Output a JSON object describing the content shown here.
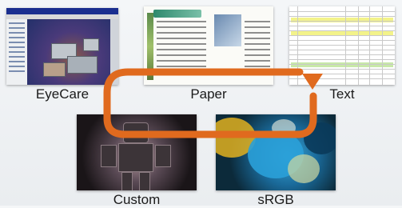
{
  "modes": [
    {
      "id": "eyecare",
      "label": "EyeCare"
    },
    {
      "id": "paper",
      "label": "Paper"
    },
    {
      "id": "text",
      "label": "Text"
    },
    {
      "id": "custom",
      "label": "Custom"
    },
    {
      "id": "srgb",
      "label": "sRGB"
    }
  ],
  "colors": {
    "arrow": "#e06a1e",
    "background": "#eef1f4"
  }
}
